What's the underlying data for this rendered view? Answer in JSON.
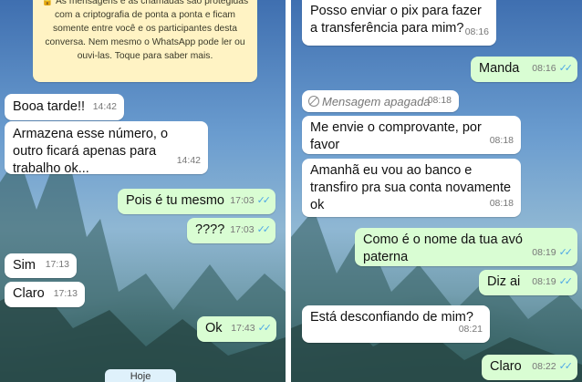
{
  "left": {
    "encryption_notice": "🔒 As mensagens e as chamadas são protegidas com a criptografia de ponta a ponta e ficam somente entre você e os participantes desta conversa. Nem mesmo o WhatsApp pode ler ou ouvi-las. Toque para saber mais.",
    "messages": [
      {
        "dir": "in",
        "text": "Booa tarde!!",
        "time": "14:42"
      },
      {
        "dir": "in",
        "text": "Armazena esse número, o outro ficará apenas para trabalho ok...",
        "time": "14:42"
      },
      {
        "dir": "out",
        "text": "Pois é tu mesmo",
        "time": "17:03"
      },
      {
        "dir": "out",
        "text": "????",
        "time": "17:03"
      },
      {
        "dir": "in",
        "text": "Sim",
        "time": "17:13"
      },
      {
        "dir": "in",
        "text": "Claro",
        "time": "17:13"
      },
      {
        "dir": "out",
        "text": "Ok",
        "time": "17:43"
      }
    ],
    "date_chip": "Hoje"
  },
  "right": {
    "messages": [
      {
        "dir": "in",
        "text": "Posso enviar o pix para fazer a transferência para mim?",
        "time": "08:16"
      },
      {
        "dir": "out",
        "text": "Manda",
        "time": "08:16"
      },
      {
        "dir": "in",
        "text": "Mensagem apagada",
        "time": "08:18",
        "deleted": true
      },
      {
        "dir": "in",
        "text": "Me envie o comprovante, por favor",
        "time": "08:18"
      },
      {
        "dir": "in",
        "text": "Amanhã eu vou ao banco e transfiro pra sua conta novamente ok",
        "time": "08:18"
      },
      {
        "dir": "out",
        "text": "Como é o nome da tua avó paterna",
        "time": "08:19"
      },
      {
        "dir": "out",
        "text": "Diz ai",
        "time": "08:19"
      },
      {
        "dir": "in",
        "text": "Está desconfiando de mim?",
        "time": "08:21"
      },
      {
        "dir": "out",
        "text": "Claro",
        "time": "08:22"
      }
    ]
  },
  "colors": {
    "incoming": "#ffffff",
    "outgoing": "#d9fdd3",
    "read_ticks": "#4fa8e6",
    "notice": "#fff3c4"
  },
  "icons": {
    "read_receipt": "double-check-icon",
    "deleted": "deleted-message-icon",
    "lock": "lock-icon"
  }
}
